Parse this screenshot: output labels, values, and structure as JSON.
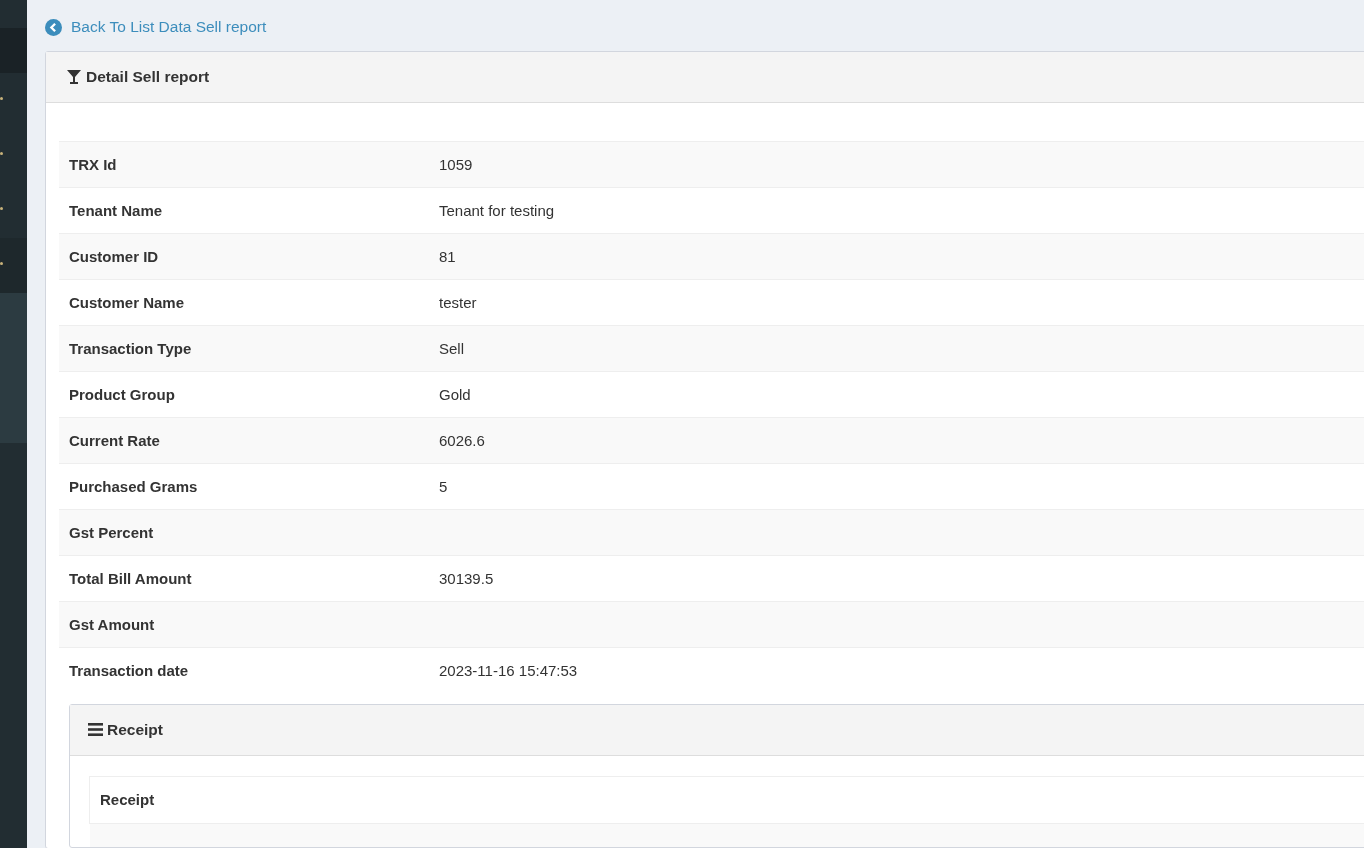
{
  "back_link": {
    "label": "Back To List Data Sell report"
  },
  "detail_panel": {
    "title": "Detail Sell report",
    "rows": [
      {
        "label": "TRX Id",
        "value": "1059"
      },
      {
        "label": "Tenant Name",
        "value": "Tenant for testing"
      },
      {
        "label": "Customer ID",
        "value": "81"
      },
      {
        "label": "Customer Name",
        "value": "tester"
      },
      {
        "label": "Transaction Type",
        "value": "Sell"
      },
      {
        "label": "Product Group",
        "value": "Gold"
      },
      {
        "label": "Current Rate",
        "value": "6026.6"
      },
      {
        "label": "Purchased Grams",
        "value": "5"
      },
      {
        "label": "Gst Percent"
      },
      {
        "label": "Total Bill Amount",
        "value": "30139.5"
      },
      {
        "label": "Gst Amount"
      },
      {
        "label": "Transaction date",
        "value": "2023-11-16 15:47:53"
      }
    ]
  },
  "receipt_panel": {
    "title": "Receipt",
    "table": {
      "columns": [
        "Receipt"
      ]
    }
  }
}
